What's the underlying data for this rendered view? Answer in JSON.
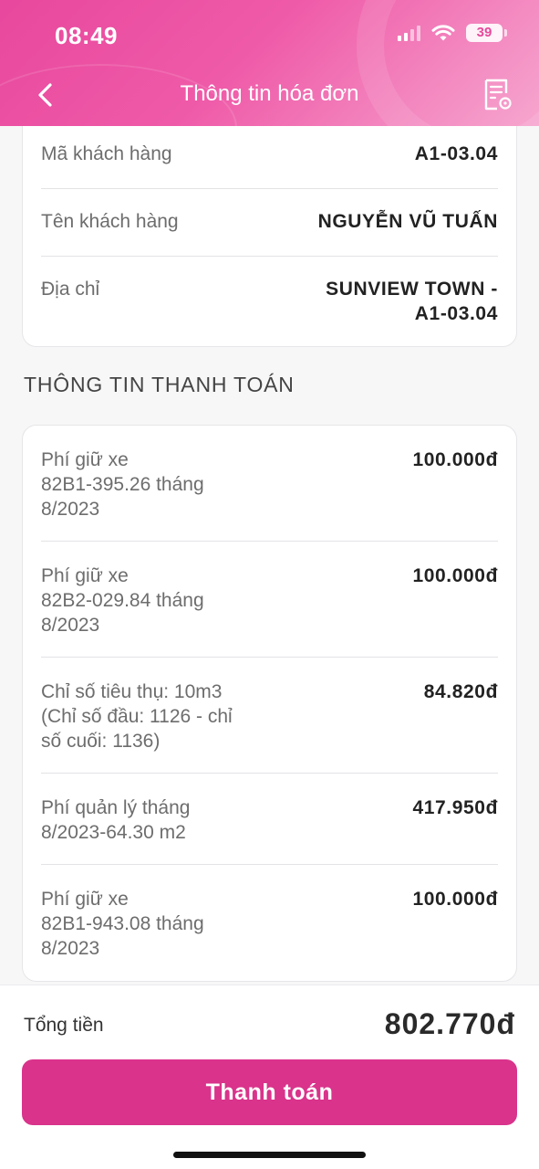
{
  "status_bar": {
    "time": "08:49",
    "battery": "39"
  },
  "nav": {
    "title": "Thông tin hóa đơn"
  },
  "customer": [
    {
      "label": "Mã khách hàng",
      "value": "A1-03.04"
    },
    {
      "label": "Tên khách hàng",
      "value": "NGUYỄN VŨ TUẤN"
    },
    {
      "label": "Địa chỉ",
      "value_line1": "SUNVIEW TOWN -",
      "value_line2": "A1-03.04"
    }
  ],
  "payment_section_title": "THÔNG TIN THANH TOÁN",
  "payment_items": [
    {
      "desc": [
        "Phí giữ xe",
        "82B1-395.26 tháng",
        "8/2023"
      ],
      "amount": "100.000đ"
    },
    {
      "desc": [
        "Phí giữ xe",
        "82B2-029.84 tháng",
        "8/2023"
      ],
      "amount": "100.000đ"
    },
    {
      "desc": [
        "Chỉ số tiêu thụ: 10m3",
        "(Chỉ số đầu: 1126 - chỉ",
        "số cuối: 1136)"
      ],
      "amount": "84.820đ"
    },
    {
      "desc": [
        "Phí quản lý tháng",
        "8/2023-64.30 m2"
      ],
      "amount": "417.950đ"
    },
    {
      "desc": [
        "Phí giữ xe",
        "82B1-943.08 tháng",
        "8/2023"
      ],
      "amount": "100.000đ"
    }
  ],
  "footer": {
    "total_label": "Tổng tiền",
    "total_value": "802.770đ",
    "pay_button": "Thanh toán"
  },
  "colors": {
    "accent": "#d9338b",
    "header_gradient_start": "#e8489d",
    "header_gradient_end": "#f6a6cf"
  },
  "icons": {
    "back": "chevron-left-icon",
    "invoice": "invoice-settings-icon",
    "wifi": "wifi-icon",
    "signal": "cellular-signal-icon",
    "battery": "battery-icon"
  }
}
